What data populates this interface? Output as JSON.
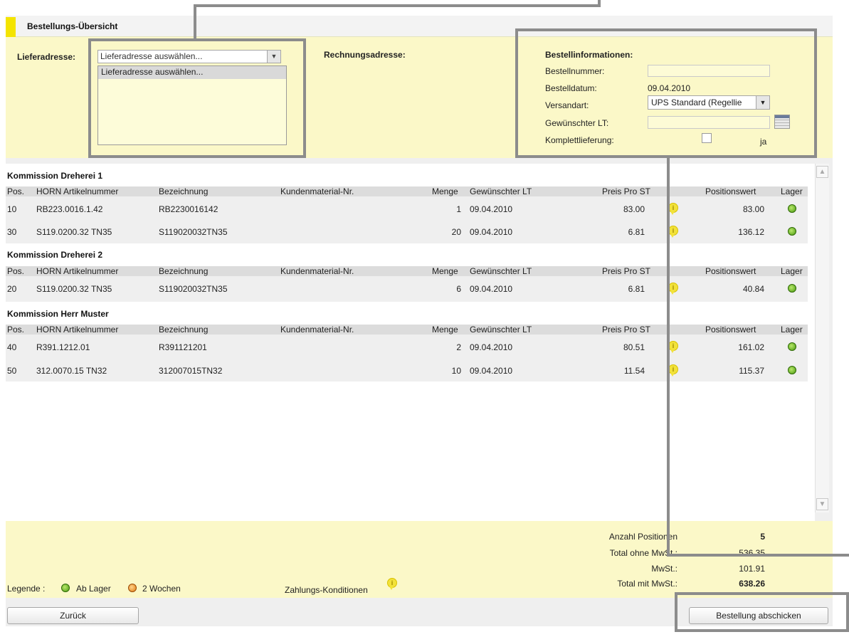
{
  "header": {
    "title": "Bestellungs-Übersicht"
  },
  "address": {
    "delivery_label": "Lieferadresse:",
    "delivery_selected": "Lieferadresse auswählen...",
    "delivery_options": [
      "Lieferadresse auswählen..."
    ],
    "billing_label": "Rechnungsadresse:"
  },
  "order_info": {
    "title": "Bestellinformationen:",
    "order_number_label": "Bestellnummer:",
    "order_number_value": "",
    "order_date_label": "Bestelldatum:",
    "order_date_value": "09.04.2010",
    "shipping_label": "Versandart:",
    "shipping_value": "UPS Standard (Regellie",
    "requested_lt_label": "Gewünschter LT:",
    "requested_lt_value": "",
    "complete_delivery_label": "Komplettlieferung:",
    "complete_delivery_checkbox_label": "ja"
  },
  "columns": {
    "pos": "Pos.",
    "article": "HORN Artikelnummer",
    "desc": "Bezeichnung",
    "customer_mat": "Kundenmaterial-Nr.",
    "qty": "Menge",
    "lt": "Gewünschter LT",
    "price": "Preis Pro ST",
    "value": "Positionswert",
    "stock": "Lager"
  },
  "groups": [
    {
      "name": "Kommission Dreherei 1",
      "rows": [
        {
          "pos": "10",
          "article": "RB223.0016.1.42",
          "desc": "RB2230016142",
          "customer_mat": "",
          "qty": "1",
          "lt": "09.04.2010",
          "price": "83.00",
          "value": "83.00",
          "stock": "Ab Lager"
        },
        {
          "pos": "30",
          "article": "S119.0200.32 TN35",
          "desc": "S119020032TN35",
          "customer_mat": "",
          "qty": "20",
          "lt": "09.04.2010",
          "price": "6.81",
          "value": "136.12",
          "stock": "Ab Lager"
        }
      ]
    },
    {
      "name": "Kommission Dreherei 2",
      "rows": [
        {
          "pos": "20",
          "article": "S119.0200.32 TN35",
          "desc": "S119020032TN35",
          "customer_mat": "",
          "qty": "6",
          "lt": "09.04.2010",
          "price": "6.81",
          "value": "40.84",
          "stock": "Ab Lager"
        }
      ]
    },
    {
      "name": "Kommission Herr Muster",
      "rows": [
        {
          "pos": "40",
          "article": "R391.1212.01",
          "desc": "R391121201",
          "customer_mat": "",
          "qty": "2",
          "lt": "09.04.2010",
          "price": "80.51",
          "value": "161.02",
          "stock": "Ab Lager"
        },
        {
          "pos": "50",
          "article": "312.0070.15 TN32",
          "desc": "312007015TN32",
          "customer_mat": "",
          "qty": "10",
          "lt": "09.04.2010",
          "price": "11.54",
          "value": "115.37",
          "stock": "Ab Lager"
        }
      ]
    }
  ],
  "totals": {
    "count_label": "Anzahl Positionen",
    "count_value": "5",
    "net_label": "Total ohne MwSt.:",
    "net_value": "536.35",
    "vat_label": "MwSt.:",
    "vat_value": "101.91",
    "gross_label": "Total mit MwSt.:",
    "gross_value": "638.26"
  },
  "legend": {
    "label": "Legende :",
    "in_stock": "Ab Lager",
    "two_weeks": "2 Wochen"
  },
  "payment_terms_label": "Zahlungs-Konditionen",
  "buttons": {
    "back": "Zurück",
    "submit": "Bestellung abschicken"
  },
  "colors": {
    "accent_yellow": "#f4e400",
    "panel_yellow": "#fbf8c8",
    "stock_green": "#4a9a10",
    "stock_orange": "#e07a10"
  }
}
